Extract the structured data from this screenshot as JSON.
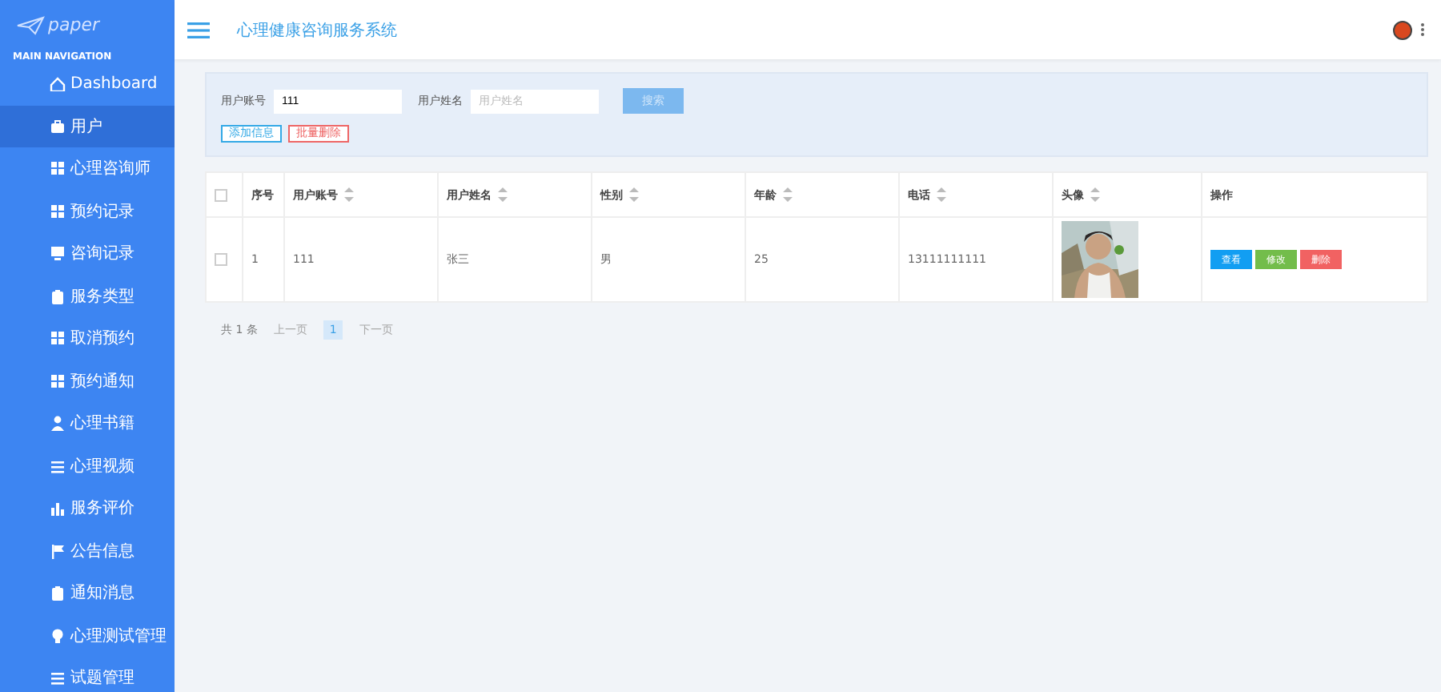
{
  "sidebar": {
    "logo": "paper",
    "section_title": "MAIN NAVIGATION",
    "items": [
      {
        "label": "Dashboard",
        "kind": "home",
        "selected": false
      },
      {
        "label": "用户",
        "kind": "case",
        "selected": true
      },
      {
        "label": "心理咨询师",
        "kind": "grid",
        "selected": false
      },
      {
        "label": "预约记录",
        "kind": "grid",
        "selected": false
      },
      {
        "label": "咨询记录",
        "kind": "monitor",
        "selected": false
      },
      {
        "label": "服务类型",
        "kind": "clip",
        "selected": false
      },
      {
        "label": "取消预约",
        "kind": "grid",
        "selected": false
      },
      {
        "label": "预约通知",
        "kind": "grid",
        "selected": false
      },
      {
        "label": "心理书籍",
        "kind": "person",
        "selected": false
      },
      {
        "label": "心理视频",
        "kind": "list",
        "selected": false
      },
      {
        "label": "服务评价",
        "kind": "bars",
        "selected": false
      },
      {
        "label": "公告信息",
        "kind": "flag",
        "selected": false
      },
      {
        "label": "通知消息",
        "kind": "clip",
        "selected": false
      },
      {
        "label": "心理测试管理",
        "kind": "bulb",
        "selected": false
      },
      {
        "label": "试题管理",
        "kind": "list",
        "selected": false
      }
    ]
  },
  "header": {
    "title": "心理健康咨询服务系统"
  },
  "search": {
    "fields": [
      {
        "label": "用户账号",
        "value": "111"
      },
      {
        "label": "用户姓名",
        "placeholder": "用户姓名"
      }
    ],
    "search_button": "搜索",
    "actions": [
      {
        "label": "添加信息",
        "kind": "add"
      },
      {
        "label": "批量删除",
        "kind": "delete"
      }
    ]
  },
  "table": {
    "select_all": {
      "checked": false
    },
    "columns": [
      {
        "label": "序号",
        "sortable": false
      },
      {
        "label": "用户账号",
        "sortable": true
      },
      {
        "label": "用户姓名",
        "sortable": true
      },
      {
        "label": "性别",
        "sortable": true
      },
      {
        "label": "年龄",
        "sortable": true
      },
      {
        "label": "电话",
        "sortable": true
      },
      {
        "label": "头像",
        "sortable": true
      },
      {
        "label": "操作",
        "sortable": false
      }
    ],
    "rows": [
      {
        "checked": false,
        "cells": [
          "1",
          "111",
          "张三",
          "男",
          "25",
          "13111111111"
        ],
        "buttons": [
          {
            "label": "查看",
            "kind": "view"
          },
          {
            "label": "修改",
            "kind": "edit"
          },
          {
            "label": "删除",
            "kind": "delete"
          }
        ]
      }
    ]
  },
  "pagination": {
    "total": "共 1 条",
    "prev": "上一页",
    "pages": [
      {
        "label": "1",
        "selected": true
      }
    ],
    "next": "下一页"
  }
}
